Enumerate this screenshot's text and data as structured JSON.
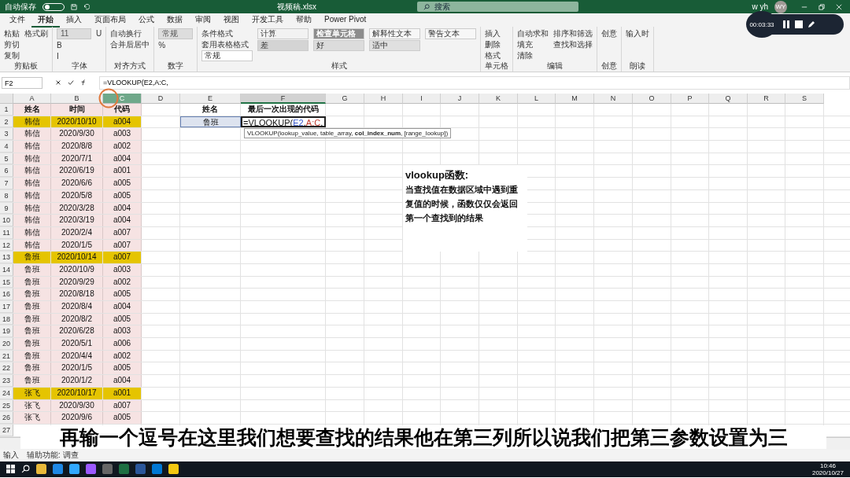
{
  "title_bar": {
    "autosave_label": "自动保存",
    "autosave_on": false,
    "file_name": "视频稿.xlsx",
    "search_placeholder": "搜索",
    "user": "w yh",
    "avatar": "WY"
  },
  "recorder": {
    "time": "00:03:33"
  },
  "menu_tabs": [
    {
      "label": "文件",
      "selected": false
    },
    {
      "label": "开始",
      "selected": true
    },
    {
      "label": "插入",
      "selected": false
    },
    {
      "label": "页面布局",
      "selected": false
    },
    {
      "label": "公式",
      "selected": false
    },
    {
      "label": "数据",
      "selected": false
    },
    {
      "label": "审阅",
      "selected": false
    },
    {
      "label": "视图",
      "selected": false
    },
    {
      "label": "开发工具",
      "selected": false
    },
    {
      "label": "帮助",
      "selected": false
    },
    {
      "label": "Power Pivot",
      "selected": false
    }
  ],
  "ribbon_groups": [
    {
      "label": "剪贴板",
      "items": [
        {
          "kind": "button",
          "text": "粘贴"
        },
        {
          "kind": "button",
          "text": "剪切"
        },
        {
          "kind": "button",
          "text": "复制"
        },
        {
          "kind": "button",
          "text": "格式刷"
        }
      ]
    },
    {
      "label": "字体",
      "items": [
        {
          "kind": "field",
          "text": "11"
        },
        {
          "kind": "button",
          "text": "B"
        },
        {
          "kind": "button",
          "text": "I"
        },
        {
          "kind": "button",
          "text": "U"
        }
      ]
    },
    {
      "label": "对齐方式",
      "items": [
        {
          "kind": "button",
          "text": "自动换行"
        },
        {
          "kind": "button",
          "text": "合并后居中"
        }
      ]
    },
    {
      "label": "数字",
      "items": [
        {
          "kind": "field",
          "text": "常规"
        },
        {
          "kind": "button",
          "text": "%"
        }
      ]
    },
    {
      "label": "样式",
      "items": [
        {
          "kind": "button",
          "text": "条件格式"
        },
        {
          "kind": "button",
          "text": "套用表格格式"
        },
        {
          "kind": "style",
          "text": "常规",
          "color": "#ffffff"
        },
        {
          "kind": "style",
          "text": "计算",
          "color": "#f2f2f2"
        },
        {
          "kind": "style",
          "text": "差",
          "color": "#d4d4d4"
        },
        {
          "kind": "style",
          "text": "检查单元格",
          "color": "#8c8c8c"
        },
        {
          "kind": "style",
          "text": "好",
          "color": "#dcdcdc"
        },
        {
          "kind": "style",
          "text": "解释性文本",
          "color": "#f7f7f7"
        },
        {
          "kind": "style",
          "text": "适中",
          "color": "#e0e0e0"
        },
        {
          "kind": "style",
          "text": "警告文本",
          "color": "#f7f7f7"
        }
      ]
    },
    {
      "label": "单元格",
      "items": [
        {
          "kind": "button",
          "text": "插入"
        },
        {
          "kind": "button",
          "text": "删除"
        },
        {
          "kind": "button",
          "text": "格式"
        }
      ]
    },
    {
      "label": "编辑",
      "items": [
        {
          "kind": "button",
          "text": "自动求和"
        },
        {
          "kind": "button",
          "text": "填充"
        },
        {
          "kind": "button",
          "text": "清除"
        },
        {
          "kind": "button",
          "text": "排序和筛选"
        },
        {
          "kind": "button",
          "text": "查找和选择"
        }
      ]
    },
    {
      "label": "创意",
      "items": [
        {
          "kind": "button",
          "text": "创意"
        }
      ]
    },
    {
      "label": "朗读",
      "items": [
        {
          "kind": "button",
          "text": "输入时"
        }
      ]
    }
  ],
  "formula_bar": {
    "name_box": "F2",
    "formula": "=VLOOKUP(E2,A:C,"
  },
  "columns": [
    {
      "label": "A",
      "selected": false,
      "hovered": false
    },
    {
      "label": "B",
      "selected": false,
      "hovered": false
    },
    {
      "label": "C",
      "selected": false,
      "hovered": true
    },
    {
      "label": "D",
      "selected": false,
      "hovered": false
    },
    {
      "label": "E",
      "selected": false,
      "hovered": false
    },
    {
      "label": "F",
      "selected": true,
      "hovered": false
    },
    {
      "label": "G",
      "selected": false,
      "hovered": false
    },
    {
      "label": "H",
      "selected": false,
      "hovered": false
    },
    {
      "label": "I",
      "selected": false,
      "hovered": false
    },
    {
      "label": "J",
      "selected": false,
      "hovered": false
    },
    {
      "label": "K",
      "selected": false,
      "hovered": false
    },
    {
      "label": "L",
      "selected": false,
      "hovered": false
    },
    {
      "label": "M",
      "selected": false,
      "hovered": false
    },
    {
      "label": "N",
      "selected": false,
      "hovered": false
    },
    {
      "label": "O",
      "selected": false,
      "hovered": false
    },
    {
      "label": "P",
      "selected": false,
      "hovered": false
    },
    {
      "label": "Q",
      "selected": false,
      "hovered": false
    },
    {
      "label": "R",
      "selected": false,
      "hovered": false
    },
    {
      "label": "S",
      "selected": false,
      "hovered": false
    }
  ],
  "rows": [
    {
      "n": "1",
      "cells": [
        "姓名",
        "时间",
        "代码"
      ],
      "highlight": false
    },
    {
      "n": "2",
      "cells": [
        "韩信",
        "2020/10/10",
        "a004"
      ],
      "highlight": true
    },
    {
      "n": "3",
      "cells": [
        "韩信",
        "2020/9/30",
        "a003"
      ],
      "highlight": false
    },
    {
      "n": "4",
      "cells": [
        "韩信",
        "2020/8/8",
        "a002"
      ],
      "highlight": false
    },
    {
      "n": "5",
      "cells": [
        "韩信",
        "2020/7/1",
        "a004"
      ],
      "highlight": false
    },
    {
      "n": "6",
      "cells": [
        "韩信",
        "2020/6/19",
        "a001"
      ],
      "highlight": false
    },
    {
      "n": "7",
      "cells": [
        "韩信",
        "2020/6/6",
        "a005"
      ],
      "highlight": false
    },
    {
      "n": "8",
      "cells": [
        "韩信",
        "2020/5/8",
        "a005"
      ],
      "highlight": false
    },
    {
      "n": "9",
      "cells": [
        "韩信",
        "2020/3/28",
        "a004"
      ],
      "highlight": false
    },
    {
      "n": "10",
      "cells": [
        "韩信",
        "2020/3/19",
        "a004"
      ],
      "highlight": false
    },
    {
      "n": "11",
      "cells": [
        "韩信",
        "2020/2/4",
        "a007"
      ],
      "highlight": false
    },
    {
      "n": "12",
      "cells": [
        "韩信",
        "2020/1/5",
        "a007"
      ],
      "highlight": false
    },
    {
      "n": "13",
      "cells": [
        "鲁班",
        "2020/10/14",
        "a007"
      ],
      "highlight": true
    },
    {
      "n": "14",
      "cells": [
        "鲁班",
        "2020/10/9",
        "a003"
      ],
      "highlight": false
    },
    {
      "n": "15",
      "cells": [
        "鲁班",
        "2020/9/29",
        "a002"
      ],
      "highlight": false
    },
    {
      "n": "16",
      "cells": [
        "鲁班",
        "2020/8/18",
        "a005"
      ],
      "highlight": false
    },
    {
      "n": "17",
      "cells": [
        "鲁班",
        "2020/8/4",
        "a004"
      ],
      "highlight": false
    },
    {
      "n": "18",
      "cells": [
        "鲁班",
        "2020/8/2",
        "a005"
      ],
      "highlight": false
    },
    {
      "n": "19",
      "cells": [
        "鲁班",
        "2020/6/28",
        "a003"
      ],
      "highlight": false
    },
    {
      "n": "20",
      "cells": [
        "鲁班",
        "2020/5/1",
        "a006"
      ],
      "highlight": false
    },
    {
      "n": "21",
      "cells": [
        "鲁班",
        "2020/4/4",
        "a002"
      ],
      "highlight": false
    },
    {
      "n": "22",
      "cells": [
        "鲁班",
        "2020/1/5",
        "a005"
      ],
      "highlight": false
    },
    {
      "n": "23",
      "cells": [
        "鲁班",
        "2020/1/2",
        "a004"
      ],
      "highlight": false
    },
    {
      "n": "24",
      "cells": [
        "张飞",
        "2020/10/17",
        "a001"
      ],
      "highlight": true
    },
    {
      "n": "25",
      "cells": [
        "张飞",
        "2020/9/30",
        "a007"
      ],
      "highlight": false
    },
    {
      "n": "26",
      "cells": [
        "张飞",
        "2020/9/6",
        "a005"
      ],
      "highlight": false
    },
    {
      "n": "27"
    }
  ],
  "lookup": {
    "headers": [
      "姓名",
      "最后一次出现的代码"
    ],
    "name": "鲁班",
    "formula_parts": [
      {
        "kind": "plain",
        "text": "=VLOOKUP("
      },
      {
        "kind": "ref",
        "text": "E2",
        "color": "#3355cc"
      },
      {
        "kind": "plain",
        "text": ","
      },
      {
        "kind": "ref",
        "text": "A:C",
        "color": "#c0392b"
      },
      {
        "kind": "plain",
        "text": ","
      }
    ]
  },
  "tooltip": "VLOOKUP(lookup_value, table_array, **col_index_num**, [range_lookup])",
  "note": {
    "title": "vlookup函数:",
    "body": "当查找值在数据区域中遇到重复值的时候，函数仅仅会返回第一个查找到的结果"
  },
  "subtitle": "再输一个逗号在这里我们想要查找的结果他在第三列所以说我们把第三参数设置为三",
  "status_bar": {
    "mode": "输入",
    "accessibility": "辅助功能: 调查"
  },
  "taskbar": {
    "time": "10:46",
    "date": "2020/10/27"
  }
}
